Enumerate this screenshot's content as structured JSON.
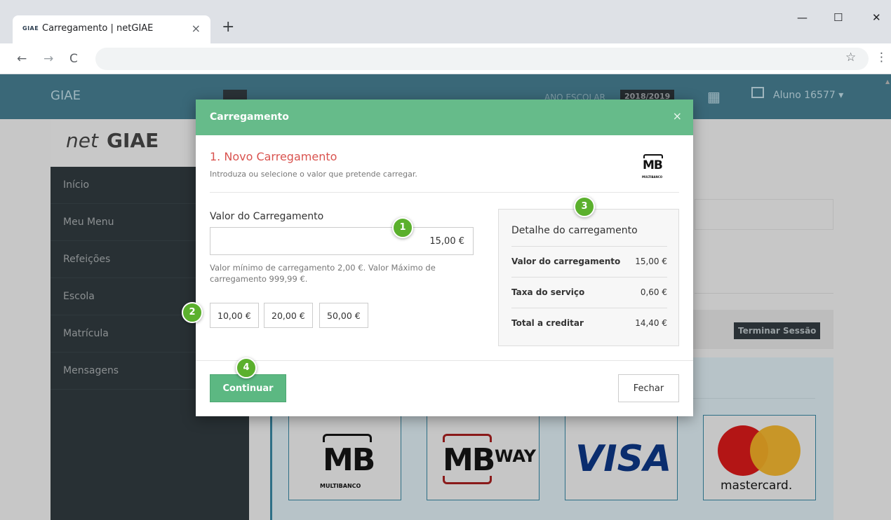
{
  "browser": {
    "tab_favicon": "GIAE",
    "tab_title": "Carregamento | netGIAE",
    "tab_close": "×",
    "new_tab": "+",
    "back": "←",
    "forward": "→",
    "reload": "C",
    "bookmark": "☆",
    "menu": "⋮",
    "minimize": "—",
    "maximize": "☐",
    "close": "✕"
  },
  "topbar": {
    "brand": "GIAE",
    "ano_label": "ANO ESCOLAR",
    "ano_value": "2018/2019",
    "user_name": "Aluno 16577 ▾"
  },
  "sidebar": {
    "logo_net": "net",
    "logo_giae": "GIAE",
    "items": [
      {
        "label": "Início"
      },
      {
        "label": "Meu Menu"
      },
      {
        "label": "Refeições"
      },
      {
        "label": "Escola"
      },
      {
        "label": "Matrícula"
      },
      {
        "label": "Mensagens"
      }
    ]
  },
  "page": {
    "terminar_label": "Terminar Sessão"
  },
  "payments": {
    "mb_text": "MB",
    "mb_sub": "MULTIBANCO",
    "mbway_mb": "MB",
    "mbway_way": "WAY",
    "visa": "VISA",
    "mastercard": "mastercard."
  },
  "modal": {
    "title": "Carregamento",
    "close": "×",
    "step_title": "1. Novo Carregamento",
    "step_sub": "Introduza ou selecione o valor que pretende carregar.",
    "mb_logo": "MB",
    "mb_logo_sub": "MULTIBANCO",
    "amount_label": "Valor do Carregamento",
    "amount_value": "15,00 €",
    "hint": "Valor mínimo de carregamento 2,00 €. Valor Máximo de carregamento 999,99 €.",
    "presets": [
      "10,00 €",
      "20,00 €",
      "50,00 €"
    ],
    "detail": {
      "title": "Detalhe do carregamento",
      "rows": [
        {
          "key": "Valor do carregamento",
          "value": "15,00 €"
        },
        {
          "key": "Taxa do serviço",
          "value": "0,60 €"
        },
        {
          "key": "Total a creditar",
          "value": "14,40 €"
        }
      ]
    },
    "continue_label": "Continuar",
    "close_label": "Fechar"
  },
  "callouts": [
    "1",
    "2",
    "3",
    "4"
  ],
  "colors": {
    "modal_header": "#66bb8a",
    "step_title": "#d9534f",
    "callout": "#5bb02d",
    "topbar": "#3a6878",
    "sidebar": "#283034"
  }
}
